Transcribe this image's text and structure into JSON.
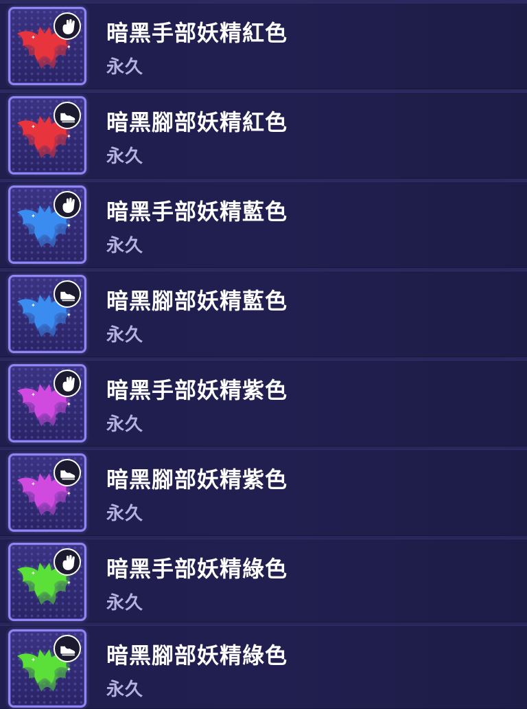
{
  "items": [
    {
      "title": "暗黑手部妖精紅色",
      "duration": "永久",
      "color": "#e8343c",
      "icon": "hand-icon"
    },
    {
      "title": "暗黑腳部妖精紅色",
      "duration": "永久",
      "color": "#e8343c",
      "icon": "shoe-icon"
    },
    {
      "title": "暗黑手部妖精藍色",
      "duration": "永久",
      "color": "#3a8cf0",
      "icon": "hand-icon"
    },
    {
      "title": "暗黑腳部妖精藍色",
      "duration": "永久",
      "color": "#3a8cf0",
      "icon": "shoe-icon"
    },
    {
      "title": "暗黑手部妖精紫色",
      "duration": "永久",
      "color": "#d04ae0",
      "icon": "hand-icon"
    },
    {
      "title": "暗黑腳部妖精紫色",
      "duration": "永久",
      "color": "#d04ae0",
      "icon": "shoe-icon"
    },
    {
      "title": "暗黑手部妖精綠色",
      "duration": "永久",
      "color": "#5ae038",
      "icon": "hand-icon"
    },
    {
      "title": "暗黑腳部妖精綠色",
      "duration": "永久",
      "color": "#5ae038",
      "icon": "shoe-icon"
    }
  ]
}
